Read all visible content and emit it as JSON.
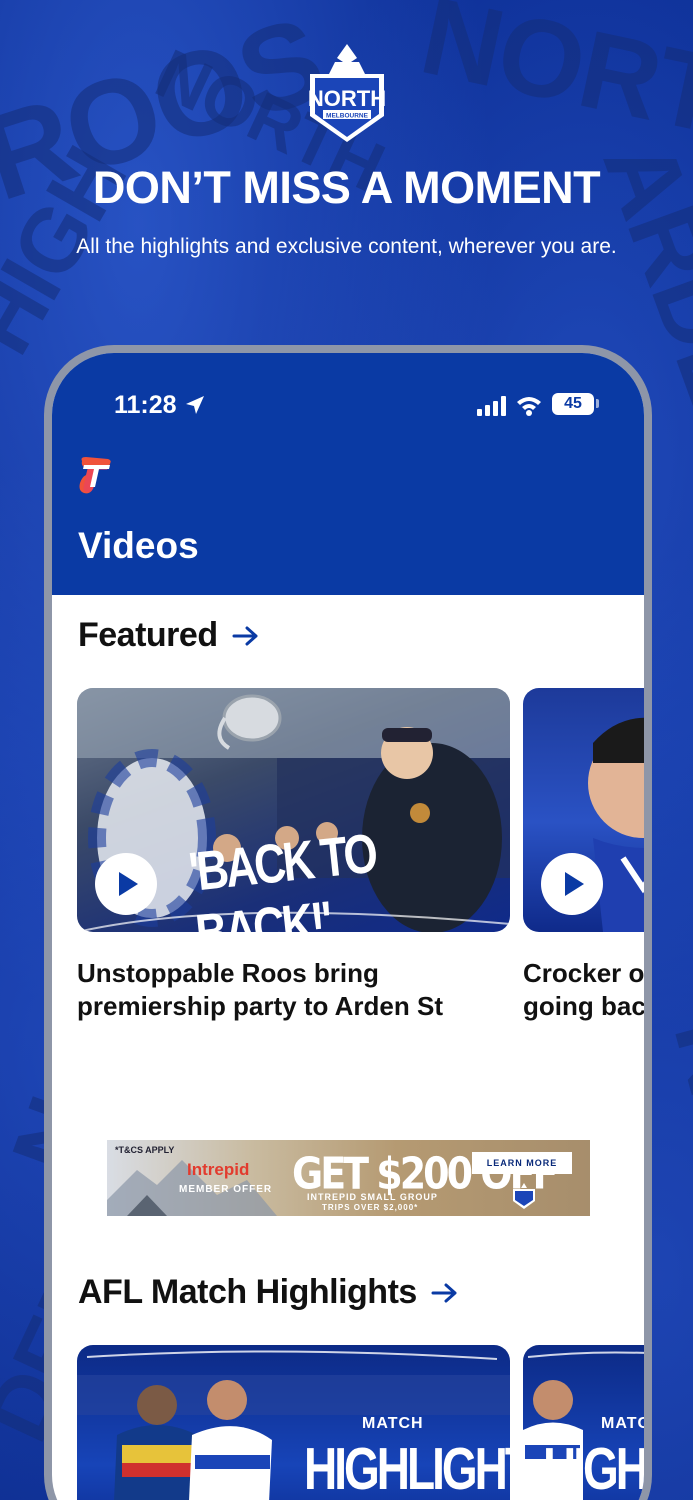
{
  "promo": {
    "headline": "DON’T MISS A MOMENT",
    "subheadline": "All the highlights and exclusive content, wherever you are.",
    "logo_text": "NORTH",
    "logo_subtext": "MELBOURNE"
  },
  "status_bar": {
    "time": "11:28",
    "battery": "45"
  },
  "app_bar": {
    "title": "Videos"
  },
  "sections": [
    {
      "title": "Featured",
      "cards": [
        {
          "title_line1": "Unstoppable Roos bring",
          "title_line2": "premiership party to Arden St",
          "overlay_text": "'BACK TO BACK!'"
        },
        {
          "title_line1": "Crocker o",
          "title_line2": "going bac",
          "overlay_text": ""
        }
      ]
    },
    {
      "title": "AFL Match Highlights",
      "cards": [
        {
          "overlay_small": "MATCH",
          "overlay_big": "HIGHLIGHTS"
        },
        {
          "overlay_small": "MATC",
          "overlay_big": "HIGHLI"
        }
      ]
    }
  ],
  "ad": {
    "tcs": "*T&CS APPLY",
    "brand": "Intrepid",
    "member": "MEMBER OFFER",
    "offer": "GET $200 OFF",
    "sub_line1": "INTREPID SMALL GROUP",
    "sub_line2": "TRIPS OVER $2,000*",
    "cta": "LEARN MORE"
  },
  "colors": {
    "brand_blue": "#0a3aa4",
    "background_blue": "#0d2f96",
    "accent_arrow": "#0a3aa4"
  }
}
